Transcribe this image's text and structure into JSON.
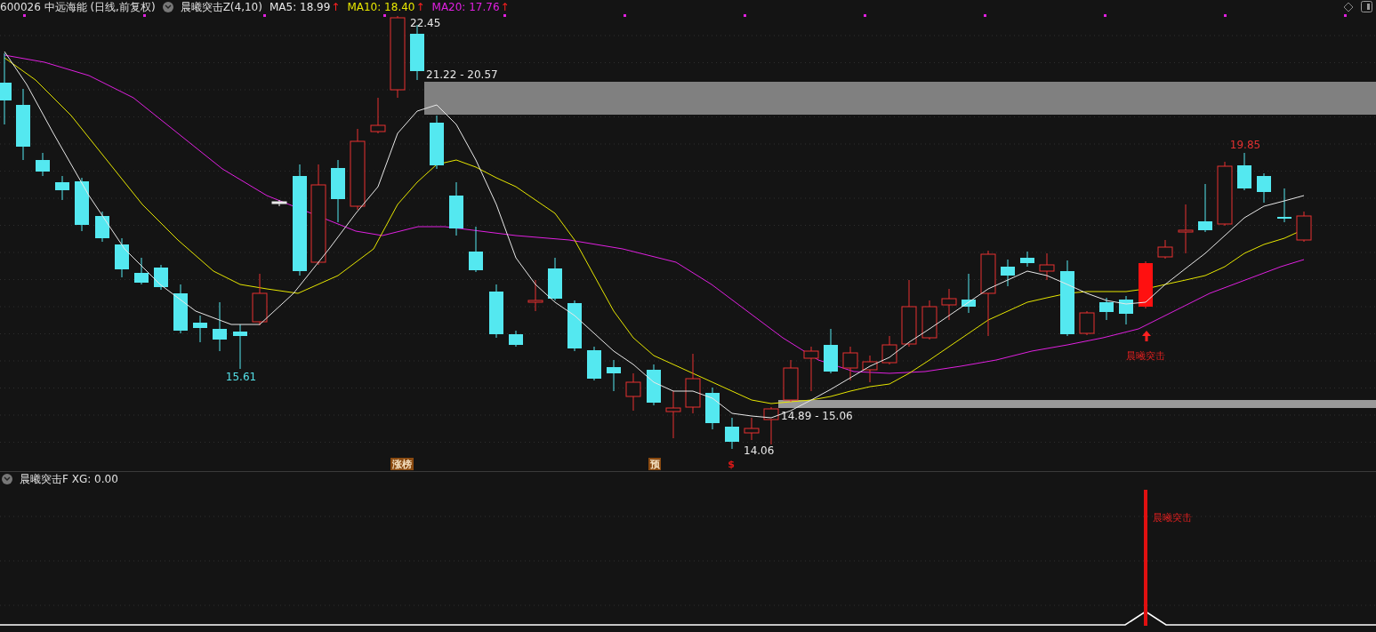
{
  "header": {
    "symbol": "600026 中远海能 (日线,前复权)",
    "indicator": "晨曦突击Z(4,10)",
    "ma": [
      {
        "label": "MA5: 18.99",
        "arrow": "↑",
        "color": "#e8e8e8"
      },
      {
        "label": "MA10: 18.40",
        "arrow": "↑",
        "color": "#e6e600"
      },
      {
        "label": "MA20: 17.76",
        "arrow": "↑",
        "color": "#e020e0"
      }
    ]
  },
  "price_labels": [
    {
      "text": "22.45",
      "color": "#e8e8e8"
    },
    {
      "text": "21.22 - 20.57",
      "color": "#e8e8e8"
    },
    {
      "text": "19.85",
      "color": "#e03030"
    },
    {
      "text": "15.61",
      "color": "#54e0e8"
    },
    {
      "text": "14.89 - 15.06",
      "color": "#e8e8e8"
    },
    {
      "text": "14.06",
      "color": "#e8e8e8"
    }
  ],
  "signal_label": "晨曦突击",
  "markers": [
    {
      "text": "涨榜",
      "color": "#8a4a10"
    },
    {
      "text": "预",
      "color": "#8a4a10"
    },
    {
      "text": "$",
      "color": "#e01818"
    }
  ],
  "lower_panel": {
    "title": "晨曦突击F XG: 0.00",
    "signal_label": "晨曦突击"
  }
}
